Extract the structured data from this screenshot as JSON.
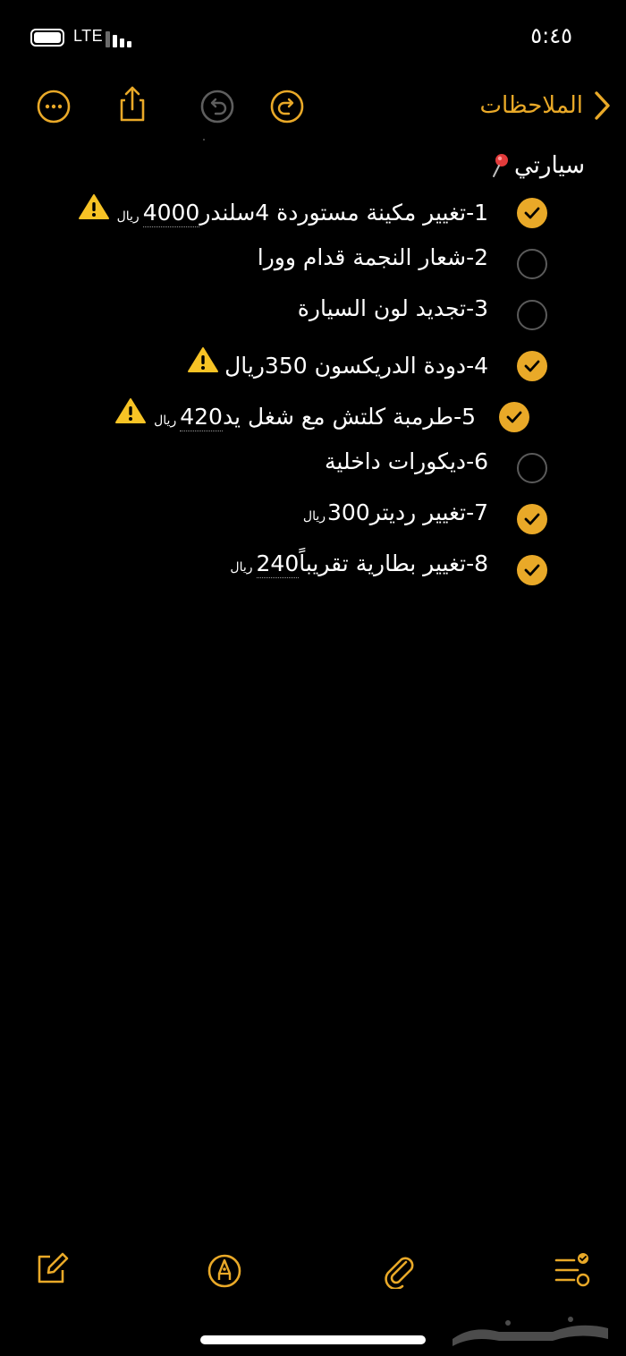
{
  "status_bar": {
    "network": "LTE",
    "time": "٥:٤٥"
  },
  "toolbar": {
    "back_label": "الملاحظات",
    "icons": [
      "more-icon",
      "share-icon",
      "undo-icon",
      "redo-icon",
      "chevron-right-icon"
    ]
  },
  "note": {
    "title": "سيارتي",
    "title_icon": "pin-icon",
    "items": [
      {
        "number": "1",
        "text": "1-تغيير مكينة مستوردة 4سلندر ",
        "amount": "4000",
        "currency": "ريال",
        "checked": true,
        "warning": true
      },
      {
        "number": "2",
        "text": "2-شعار النجمة قدام وورا",
        "amount": "",
        "currency": "",
        "checked": false,
        "warning": false
      },
      {
        "number": "3",
        "text": "3-تجديد لون السيارة",
        "amount": "",
        "currency": "",
        "checked": false,
        "warning": false
      },
      {
        "number": "4",
        "text": "4-دودة الدريكسون 350ريال",
        "amount": "",
        "currency": "",
        "checked": true,
        "warning": true
      },
      {
        "number": "5",
        "text": "5-طرمبة كلتش مع شغل يد ",
        "amount": "420",
        "currency": "ريال",
        "checked": true,
        "warning": true
      },
      {
        "number": "6",
        "text": "6-ديكورات داخلية",
        "amount": "",
        "currency": "",
        "checked": false,
        "warning": false
      },
      {
        "number": "7",
        "text": "7-تغيير رديتر300",
        "amount": "",
        "currency": "ريال",
        "checked": true,
        "warning": false
      },
      {
        "number": "8",
        "text": "8-تغيير بطارية تقريباً ",
        "amount": "240",
        "currency": "ريال",
        "checked": true,
        "warning": false
      }
    ]
  },
  "bottom_bar": {
    "icons": [
      "compose-icon",
      "markup-icon",
      "attachment-icon",
      "checklist-icon"
    ]
  },
  "colors": {
    "accent": "#e9a928",
    "background": "#000000",
    "text": "#ffffff",
    "unchecked_border": "#5a5a5a",
    "warning": "#f7c325"
  },
  "watermark": "حراج"
}
